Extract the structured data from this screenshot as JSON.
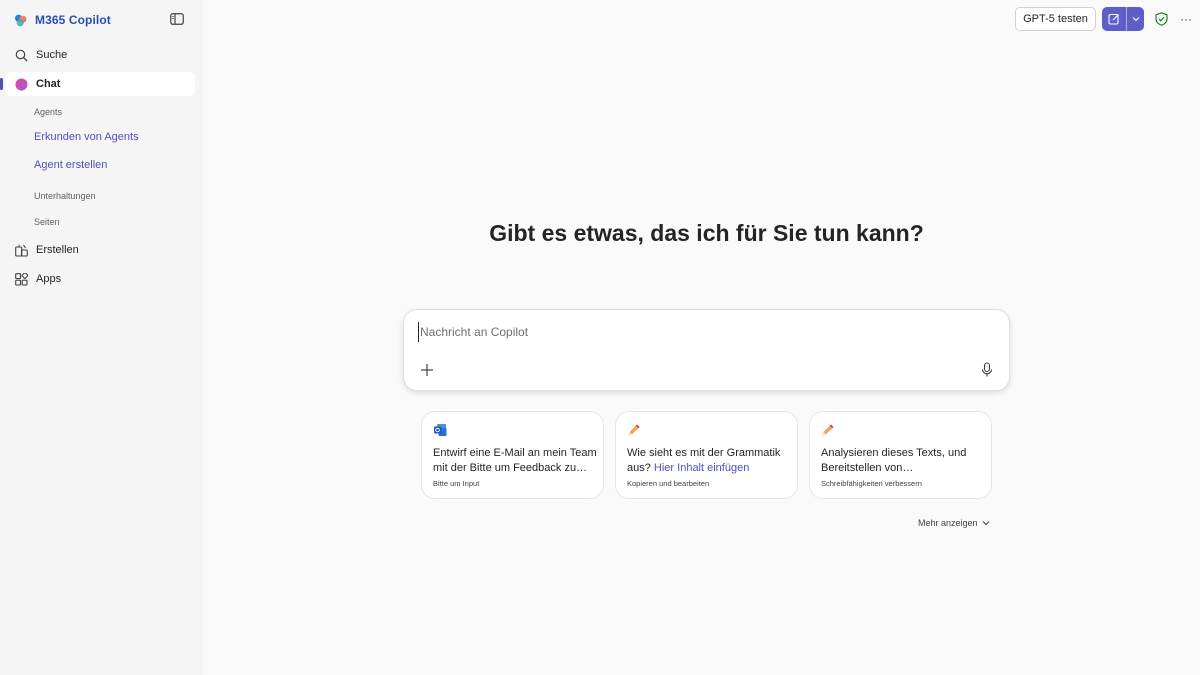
{
  "app": {
    "name": "M365 Copilot"
  },
  "sidebar": {
    "search_label": "Suche",
    "chat_label": "Chat",
    "agents_section": "Agents",
    "explore_agents": "Erkunden von Agents",
    "create_agent": "Agent erstellen",
    "conversations_section": "Unterhaltungen",
    "pages_section": "Seiten",
    "create_label": "Erstellen",
    "apps_label": "Apps"
  },
  "header": {
    "gpt_button": "GPT-5 testen",
    "more_label": "···"
  },
  "main": {
    "headline": "Gibt es etwas, das ich für Sie tun kann?",
    "composer_placeholder": "Nachricht an Copilot",
    "show_more": "Mehr anzeigen"
  },
  "suggestions": [
    {
      "icon": "outlook-icon",
      "title": "Entwirf eine E-Mail an mein Team mit der Bitte um Feedback zu…",
      "subtitle": "Bitte um Input"
    },
    {
      "icon": "pencil-icon",
      "title_prefix": "Wie sieht es mit der Grammatik aus?",
      "title_link": "Hier Inhalt einfügen",
      "subtitle": "Kopieren und bearbeiten"
    },
    {
      "icon": "pencil-icon",
      "title": "Analysieren dieses Texts, und Bereitstellen von…",
      "subtitle": "Schreibfähigkeiten verbessern"
    }
  ],
  "colors": {
    "accent": "#5b5fc7",
    "brand_text": "#2b4fb6",
    "link": "#4f52b2",
    "shield": "#107c10"
  }
}
